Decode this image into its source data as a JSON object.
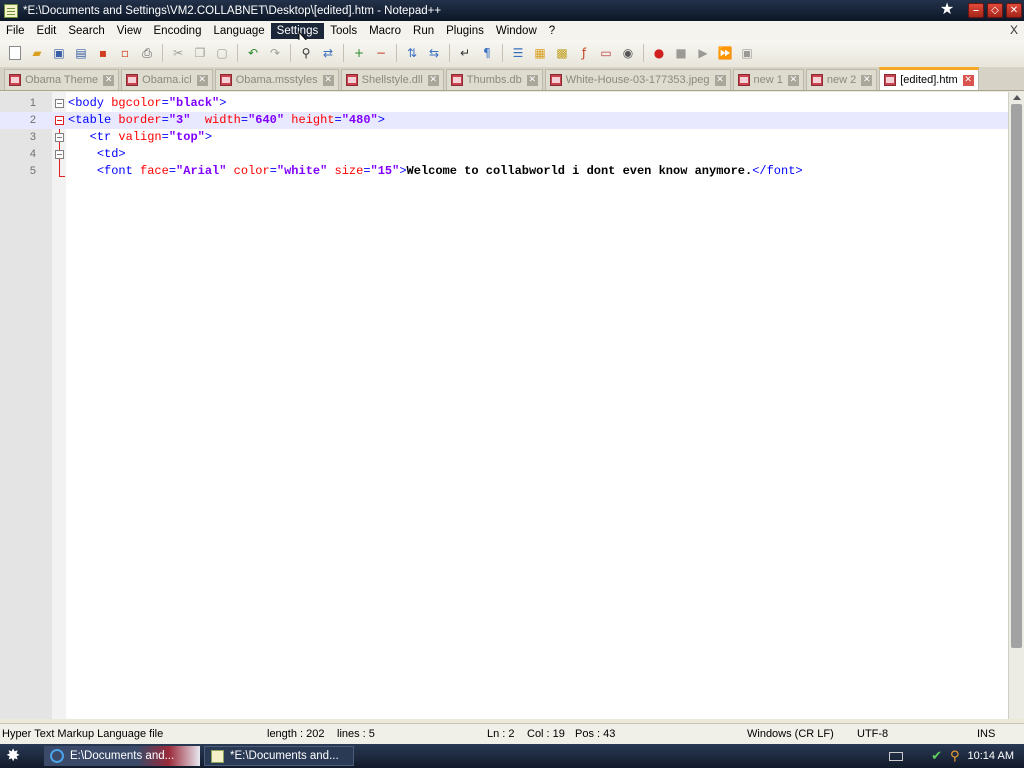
{
  "window": {
    "title": "*E:\\Documents and Settings\\VM2.COLLABNET\\Desktop\\[edited].htm - Notepad++"
  },
  "menu": {
    "items": [
      "File",
      "Edit",
      "Search",
      "View",
      "Encoding",
      "Language",
      "Settings",
      "Tools",
      "Macro",
      "Run",
      "Plugins",
      "Window",
      "?"
    ],
    "active": "Settings",
    "close_label": "X"
  },
  "toolbar": {
    "icons": [
      "new-file-icon",
      "open-file-icon",
      "save-icon",
      "save-all-icon",
      "close-icon",
      "close-all-icon",
      "print-icon",
      "cut-icon",
      "copy-icon",
      "paste-icon",
      "undo-icon",
      "redo-icon",
      "find-icon",
      "replace-icon",
      "zoom-in-icon",
      "zoom-out-icon",
      "sync-vertical-icon",
      "sync-horizontal-icon",
      "word-wrap-icon",
      "show-all-chars-icon",
      "indent-guide-icon",
      "user-lang-icon",
      "doc-map-icon",
      "function-list-icon",
      "folder-as-workspace-icon",
      "monitoring-icon",
      "record-macro-icon",
      "stop-record-icon",
      "play-macro-icon",
      "run-macro-multiple-icon",
      "save-macro-icon"
    ]
  },
  "tabs": [
    {
      "label": "Obama Theme",
      "active": false
    },
    {
      "label": "Obama.icl",
      "active": false
    },
    {
      "label": "Obama.msstyles",
      "active": false
    },
    {
      "label": "Shellstyle.dll",
      "active": false
    },
    {
      "label": "Thumbs.db",
      "active": false
    },
    {
      "label": "White-House-03-177353.jpeg",
      "active": false
    },
    {
      "label": "new 1",
      "active": false
    },
    {
      "label": "new 2",
      "active": false
    },
    {
      "label": "[edited].htm",
      "active": true
    }
  ],
  "editor": {
    "lines": [
      {
        "number": "1",
        "indent": "",
        "tokens": [
          [
            "tag",
            "<body "
          ],
          [
            "attr",
            "bgcolor"
          ],
          [
            "tag",
            "="
          ],
          [
            "val",
            "\"black\""
          ],
          [
            "tag",
            ">"
          ]
        ]
      },
      {
        "number": "2",
        "indent": "",
        "tokens": [
          [
            "tag",
            "<table "
          ],
          [
            "attr",
            "border"
          ],
          [
            "tag",
            "="
          ],
          [
            "val",
            "\"3\""
          ],
          [
            "tag",
            "  "
          ],
          [
            "attr",
            "width"
          ],
          [
            "tag",
            "="
          ],
          [
            "val",
            "\"640\""
          ],
          [
            "tag",
            " "
          ],
          [
            "attr",
            "height"
          ],
          [
            "tag",
            "="
          ],
          [
            "val",
            "\"480\""
          ],
          [
            "tag",
            ">"
          ]
        ]
      },
      {
        "number": "3",
        "indent": "   ",
        "tokens": [
          [
            "tag",
            "<tr "
          ],
          [
            "attr",
            "valign"
          ],
          [
            "tag",
            "="
          ],
          [
            "val",
            "\"top\""
          ],
          [
            "tag",
            ">"
          ]
        ]
      },
      {
        "number": "4",
        "indent": "    ",
        "tokens": [
          [
            "tag",
            "<td>"
          ]
        ]
      },
      {
        "number": "5",
        "indent": "    ",
        "tokens": [
          [
            "tag",
            "<font "
          ],
          [
            "attr",
            "face"
          ],
          [
            "tag",
            "="
          ],
          [
            "val",
            "\"Arial\""
          ],
          [
            "tag",
            " "
          ],
          [
            "attr",
            "color"
          ],
          [
            "tag",
            "="
          ],
          [
            "val",
            "\"white\""
          ],
          [
            "tag",
            " "
          ],
          [
            "attr",
            "size"
          ],
          [
            "tag",
            "="
          ],
          [
            "val",
            "\"15\""
          ],
          [
            "tag",
            ">"
          ],
          [
            "txt",
            "Welcome to collabworld i dont even know anymore."
          ],
          [
            "tag",
            "</font>"
          ]
        ]
      }
    ],
    "current_line": 2
  },
  "status": {
    "file_type": "Hyper Text Markup Language file",
    "length": "length : 202",
    "lines": "lines : 5",
    "ln": "Ln : 2",
    "col": "Col : 19",
    "pos": "Pos : 43",
    "eol": "Windows (CR LF)",
    "encoding": "UTF-8",
    "mode": "INS"
  },
  "taskbar": {
    "task1": "E:\\Documents and...",
    "task2": "*E:\\Documents and...",
    "clock": "10:14 AM"
  },
  "colors": {
    "tag": "#0000ff",
    "attribute": "#ff0000",
    "value": "#8000ff",
    "active_tab_accent": "#f5a623",
    "current_line_bg": "#e8e8ff"
  }
}
